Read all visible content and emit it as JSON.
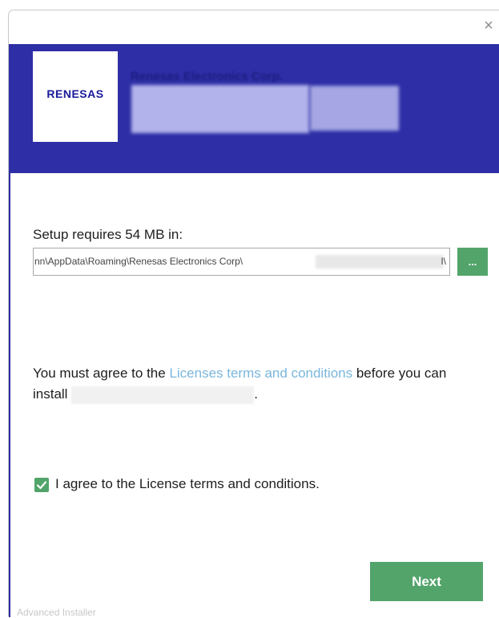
{
  "window": {
    "close_glyph": "×"
  },
  "header": {
    "logo_text": "RENESAS",
    "vendor_name": "Renesas Electronics Corp.",
    "background_color": "#2e2ea6"
  },
  "install_location": {
    "label": "Setup requires 54 MB in:",
    "path_value": "nn\\AppData\\Roaming\\Renesas Electronics Corp\\",
    "path_end": "I\\",
    "browse_label": "..."
  },
  "license": {
    "text_before_link": "You must agree to the ",
    "link_text": "Licenses terms and conditions",
    "text_after_link": " before you can install ",
    "text_end": ".",
    "link_color": "#7ab6dc"
  },
  "agreement": {
    "checked": true,
    "label": "I agree to the License terms and conditions."
  },
  "actions": {
    "next_label": "Next",
    "accent_color": "#53a46b"
  },
  "footer": {
    "brand": "Advanced Installer"
  }
}
